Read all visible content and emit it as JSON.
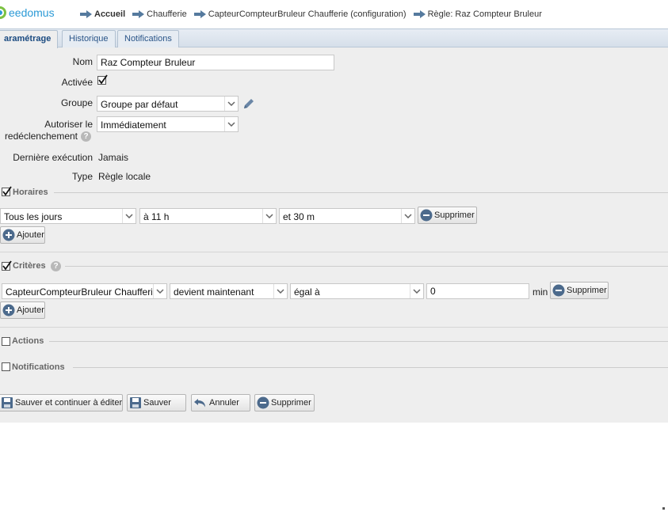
{
  "header": {
    "logo_text": "eedomus",
    "breadcrumb": [
      "Accueil",
      "Chaufferie",
      "CapteurCompteurBruleur Chaufferie (configuration)",
      "Règle: Raz Compteur Bruleur"
    ]
  },
  "tabs": [
    "aramétrage",
    "Historique",
    "Notifications"
  ],
  "form": {
    "nom_label": "Nom",
    "nom_value": "Raz Compteur Bruleur",
    "activee_label": "Activée",
    "groupe_label": "Groupe",
    "groupe_value": "Groupe par défaut",
    "autoriser_label_1": "Autoriser le",
    "autoriser_label_2": "redéclenchement",
    "autoriser_value": "Immédiatement",
    "derniere_label": "Dernière exécution",
    "derniere_value": "Jamais",
    "type_label": "Type",
    "type_value": "Règle locale"
  },
  "horaires": {
    "title": "Horaires",
    "day": "Tous les jours",
    "hour": "à 11 h",
    "minute": "et 30 m",
    "delete_label": "Supprimer",
    "add_label": "Ajouter"
  },
  "criteres": {
    "title": "Critères",
    "device": "CapteurCompteurBruleur Chaufferie",
    "condition": "devient maintenant",
    "operator": "égal à",
    "value": "0",
    "unit": "min",
    "delete_label": "Supprimer",
    "add_label": "Ajouter"
  },
  "actions": {
    "title": "Actions"
  },
  "notifications": {
    "title": "Notifications"
  },
  "footer": {
    "save_continue": "Sauver et continuer à éditer",
    "save": "Sauver",
    "cancel": "Annuler",
    "delete": "Supprimer"
  },
  "colors": {
    "accent": "#2b9ad6",
    "logo_green": "#7cc242",
    "panel_bg": "#eeeeee"
  }
}
